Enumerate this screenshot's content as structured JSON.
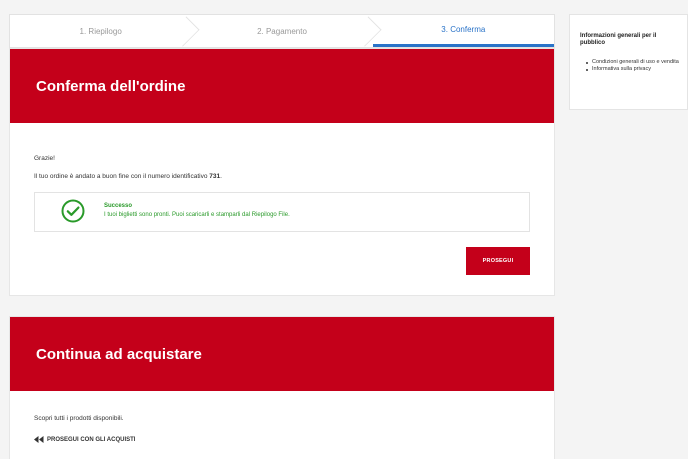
{
  "stepper": {
    "steps": [
      {
        "label": "1. Riepilogo",
        "active": false
      },
      {
        "label": "2. Pagamento",
        "active": false
      },
      {
        "label": "3. Conferma",
        "active": true
      }
    ]
  },
  "confirm": {
    "title": "Conferma dell'ordine",
    "thanks": "Grazie!",
    "order_text": "Il tuo ordine è andato a buon fine con il numero identificativo ",
    "order_number": "731",
    "order_suffix": ".",
    "success": {
      "title": "Successo",
      "message": "I tuoi biglietti sono pronti. Puoi scaricarli e stamparli dal Riepilogo File."
    },
    "continue_button": "PROSEGUI"
  },
  "continue_shopping": {
    "title": "Continua ad acquistare",
    "text": "Scopri tutti i prodotti disponibili.",
    "link": "PROSEGUI CON GLI ACQUISTI"
  },
  "sidebar": {
    "title": "Informazioni generali per il pubblico",
    "items": [
      "Condizioni generali di uso e vendita",
      "Informativa sulla privacy"
    ]
  },
  "colors": {
    "brand_red": "#c4001a",
    "success_green": "#2a9a2a",
    "active_step_blue": "#2a73c8"
  }
}
